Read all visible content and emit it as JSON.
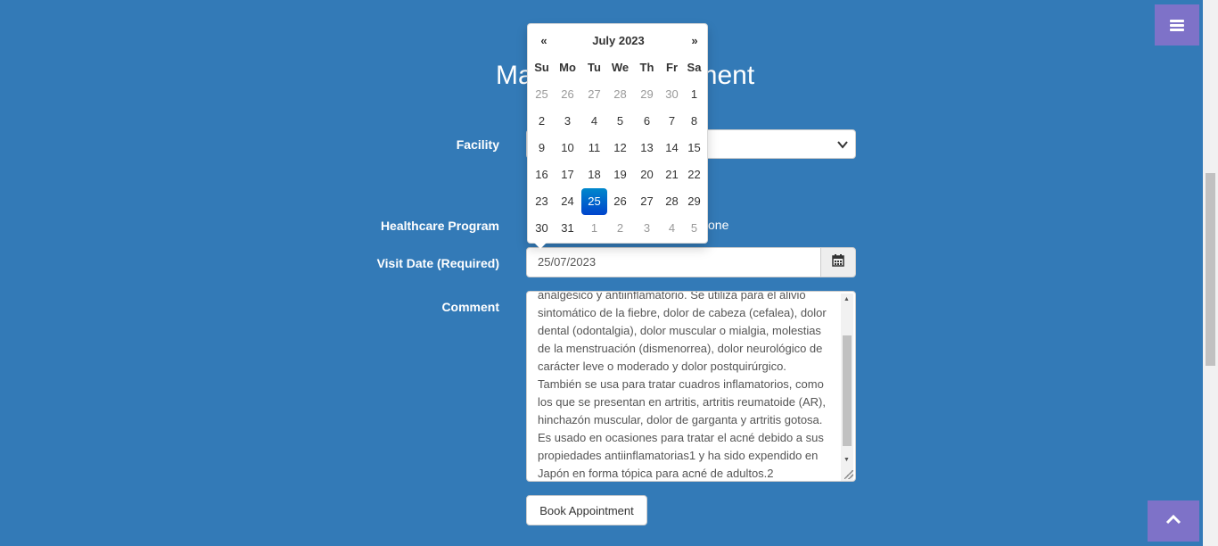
{
  "heading": "Make an Appointment",
  "form": {
    "facility_label": "Facility",
    "program_label": "Healthcare Program",
    "program_visible_option": "one",
    "visit_date_label": "Visit Date (Required)",
    "visit_date_value": "25/07/2023",
    "comment_label": "Comment",
    "comment_lines": [
      "analgésico y antiinflamatorio. Se utiliza para el alivio",
      "sintomático de la fiebre, dolor de cabeza (cefalea), dolor",
      "dental (odontalgia), dolor muscular o mialgia, molestias",
      "de la menstruación (dismenorrea), dolor neurológico de",
      "carácter leve o moderado y dolor postquirúrgico.",
      "También se usa para tratar cuadros inflamatorios, como",
      "los que se presentan en artritis, artritis reumatoide (AR),",
      "hinchazón muscular, dolor de garganta y artritis gotosa.",
      "Es usado en ocasiones para tratar el acné debido a sus",
      "propiedades antiinflamatorias1 y ha sido expendido en",
      "Japón en forma tópica para acné de adultos.2"
    ],
    "book_button": "Book Appointment"
  },
  "datepicker": {
    "prev": "«",
    "next": "»",
    "month_label": "July 2023",
    "weekdays": [
      "Su",
      "Mo",
      "Tu",
      "We",
      "Th",
      "Fr",
      "Sa"
    ],
    "weeks": [
      [
        {
          "d": "25",
          "c": "old"
        },
        {
          "d": "26",
          "c": "old"
        },
        {
          "d": "27",
          "c": "old"
        },
        {
          "d": "28",
          "c": "old"
        },
        {
          "d": "29",
          "c": "old"
        },
        {
          "d": "30",
          "c": "old"
        },
        {
          "d": "1",
          "c": ""
        }
      ],
      [
        {
          "d": "2",
          "c": ""
        },
        {
          "d": "3",
          "c": ""
        },
        {
          "d": "4",
          "c": ""
        },
        {
          "d": "5",
          "c": ""
        },
        {
          "d": "6",
          "c": ""
        },
        {
          "d": "7",
          "c": ""
        },
        {
          "d": "8",
          "c": ""
        }
      ],
      [
        {
          "d": "9",
          "c": ""
        },
        {
          "d": "10",
          "c": ""
        },
        {
          "d": "11",
          "c": ""
        },
        {
          "d": "12",
          "c": ""
        },
        {
          "d": "13",
          "c": ""
        },
        {
          "d": "14",
          "c": ""
        },
        {
          "d": "15",
          "c": ""
        }
      ],
      [
        {
          "d": "16",
          "c": ""
        },
        {
          "d": "17",
          "c": ""
        },
        {
          "d": "18",
          "c": ""
        },
        {
          "d": "19",
          "c": ""
        },
        {
          "d": "20",
          "c": ""
        },
        {
          "d": "21",
          "c": ""
        },
        {
          "d": "22",
          "c": ""
        }
      ],
      [
        {
          "d": "23",
          "c": ""
        },
        {
          "d": "24",
          "c": ""
        },
        {
          "d": "25",
          "c": "active"
        },
        {
          "d": "26",
          "c": ""
        },
        {
          "d": "27",
          "c": ""
        },
        {
          "d": "28",
          "c": ""
        },
        {
          "d": "29",
          "c": ""
        }
      ],
      [
        {
          "d": "30",
          "c": ""
        },
        {
          "d": "31",
          "c": ""
        },
        {
          "d": "1",
          "c": "new"
        },
        {
          "d": "2",
          "c": "new"
        },
        {
          "d": "3",
          "c": "new"
        },
        {
          "d": "4",
          "c": "new"
        },
        {
          "d": "5",
          "c": "new"
        }
      ]
    ]
  },
  "icons": {
    "menu": "hamburger-icon",
    "back_to_top": "chevron-up-icon",
    "calendar": "calendar-icon",
    "select_chevron": "chevron-down-icon"
  },
  "colors": {
    "background": "#337ab7",
    "accent_button": "#7e72c8",
    "active_day": "#0044cc"
  }
}
